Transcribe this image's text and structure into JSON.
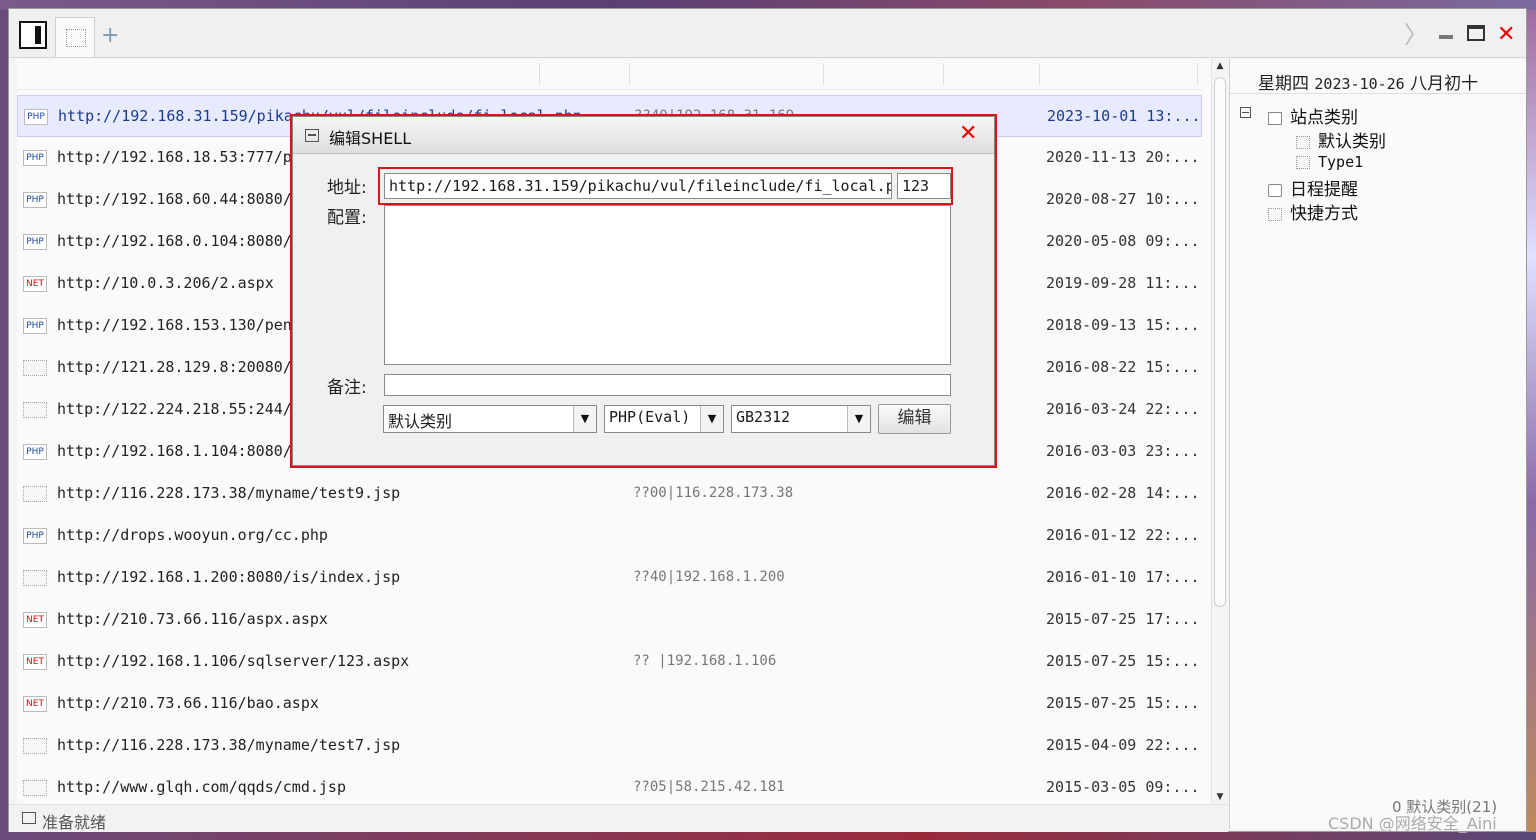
{
  "tabbar": {
    "add_label": "+",
    "next_glyph": "〉",
    "close_glyph": "✕"
  },
  "rows": [
    {
      "type": "PHP",
      "url": "http://192.168.31.159/pikachu/vul/fileinclude/fi_local.php",
      "ip": "??40|192.168.31.169",
      "date": "2023-10-01 13:...",
      "selected": true
    },
    {
      "type": "PHP",
      "url": "http://192.168.18.53:777/pi",
      "ip": "",
      "date": "2020-11-13 20:..."
    },
    {
      "type": "PHP",
      "url": "http://192.168.60.44:8080/1",
      "ip": "",
      "date": "2020-08-27 10:..."
    },
    {
      "type": "PHP",
      "url": "http://192.168.0.104:8080/d",
      "ip": "",
      "date": "2020-05-08 09:..."
    },
    {
      "type": "NET",
      "url": "http://10.0.3.206/2.aspx",
      "ip": "",
      "date": "2019-09-28 11:..."
    },
    {
      "type": "PHP",
      "url": "http://192.168.153.130/pent",
      "ip": "",
      "date": "2018-09-13 15:..."
    },
    {
      "type": "",
      "url": "http://121.28.129.8:20080/a",
      "ip": "",
      "date": "2016-08-22 15:..."
    },
    {
      "type": "",
      "url": "http://122.224.218.55:244/i",
      "ip": "",
      "date": "2016-03-24 22:..."
    },
    {
      "type": "PHP",
      "url": "http://192.168.1.104:8080/d",
      "ip": "",
      "date": "2016-03-03 23:..."
    },
    {
      "type": "",
      "url": "http://116.228.173.38/myname/test9.jsp",
      "ip": "??00|116.228.173.38",
      "date": "2016-02-28 14:..."
    },
    {
      "type": "PHP",
      "url": "http://drops.wooyun.org/cc.php",
      "ip": "",
      "date": "2016-01-12 22:..."
    },
    {
      "type": "",
      "url": "http://192.168.1.200:8080/is/index.jsp",
      "ip": "??40|192.168.1.200",
      "date": "2016-01-10 17:..."
    },
    {
      "type": "NET",
      "url": "http://210.73.66.116/aspx.aspx",
      "ip": "",
      "date": "2015-07-25 17:..."
    },
    {
      "type": "NET",
      "url": "http://192.168.1.106/sqlserver/123.aspx",
      "ip": "?? |192.168.1.106",
      "date": "2015-07-25 15:..."
    },
    {
      "type": "NET",
      "url": "http://210.73.66.116/bao.aspx",
      "ip": "",
      "date": "2015-07-25 15:..."
    },
    {
      "type": "",
      "url": "http://116.228.173.38/myname/test7.jsp",
      "ip": "",
      "date": "2015-04-09 22:..."
    },
    {
      "type": "",
      "url": "http://www.glqh.com/qqds/cmd.jsp",
      "ip": "??05|58.215.42.181",
      "date": "2015-03-05 09:..."
    }
  ],
  "side": {
    "weekday": "星期四",
    "date": "2023-10-26",
    "lunar": "八月初十",
    "tree": {
      "root_toggle": "⊟",
      "root": "站点类别",
      "children": [
        "默认类别",
        "Type1"
      ],
      "schedule": "日程提醒",
      "shortcuts": "快捷方式"
    }
  },
  "status": {
    "text": "准备就绪",
    "right": "0 默认类别(21)"
  },
  "watermark": "CSDN @网络安全_Aini",
  "dialog": {
    "title": "编辑SHELL",
    "close": "✕",
    "address_label": "地址:",
    "address_value": "http://192.168.31.159/pikachu/vul/fileinclude/fi_local.php",
    "password_value": "123",
    "config_label": "配置:",
    "config_value": "",
    "note_label": "备注:",
    "note_value": "",
    "category": "默认类别",
    "script_type": "PHP(Eval)",
    "encoding": "GB2312",
    "submit_label": "编辑",
    "arrow": "▼"
  }
}
